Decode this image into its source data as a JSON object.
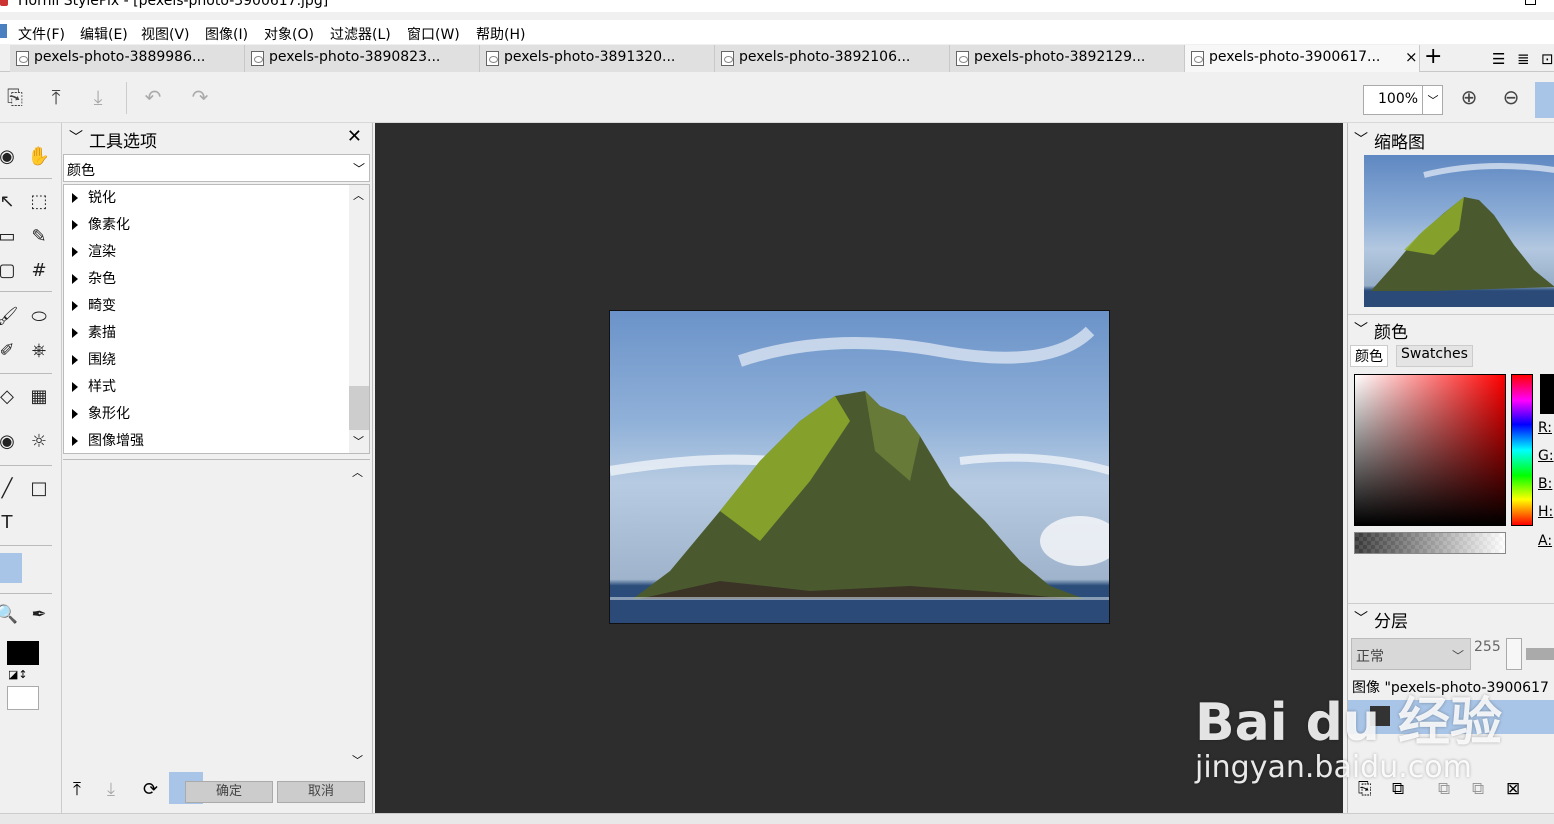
{
  "window": {
    "title": "Hornil StylePix - [pexels-photo-3900617.jpg]"
  },
  "menu": [
    {
      "label": "文件(F)"
    },
    {
      "label": "编辑(E)"
    },
    {
      "label": "视图(V)"
    },
    {
      "label": "图像(I)"
    },
    {
      "label": "对象(O)"
    },
    {
      "label": "过滤器(L)"
    },
    {
      "label": "窗口(W)"
    },
    {
      "label": "帮助(H)"
    }
  ],
  "tabs": [
    {
      "label": "pexels-photo-3889986..."
    },
    {
      "label": "pexels-photo-3890823..."
    },
    {
      "label": "pexels-photo-3891320..."
    },
    {
      "label": "pexels-photo-3892106..."
    },
    {
      "label": "pexels-photo-3892129..."
    },
    {
      "label": "pexels-photo-3900617...",
      "close": "×"
    }
  ],
  "toolbar": {
    "zoom": "100%"
  },
  "tool_options": {
    "title": "工具选项",
    "category": "颜色",
    "filters": [
      "锐化",
      "像素化",
      "渲染",
      "杂色",
      "畸变",
      "素描",
      "围绕",
      "样式",
      "象形化",
      "图像增强"
    ],
    "ok": "确定",
    "cancel": "取消"
  },
  "thumbnail": {
    "title": "缩略图"
  },
  "color": {
    "title": "颜色",
    "tab_color": "颜色",
    "tab_swatches": "Swatches",
    "channels": [
      "R:",
      "G:",
      "B:",
      "H:",
      "A:"
    ]
  },
  "layers": {
    "title": "分层",
    "blend": "正常",
    "opacity": "255",
    "image_row": "图像 \"pexels-photo-3900617"
  },
  "watermark": {
    "main": "Bai du 经验",
    "sub": "jingyan.baidu.com"
  },
  "colors": {
    "canvas_bg": "#2d2d2d",
    "selection": "#a8c4e6"
  }
}
